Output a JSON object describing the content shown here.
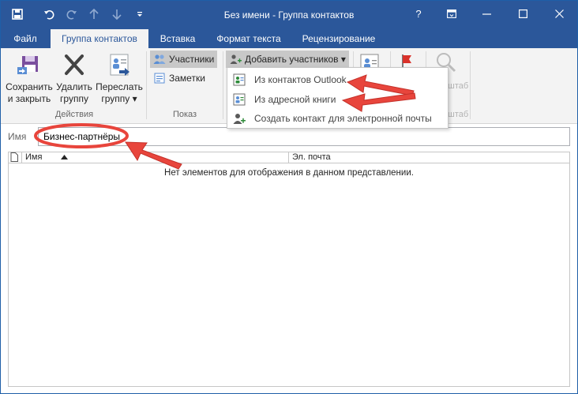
{
  "window": {
    "title": "Без имени - Группа контактов",
    "controls": {
      "help": "?",
      "ribbon_options": "ribbon-display-options-icon",
      "minimize": "minimize-icon",
      "maximize": "maximize-icon",
      "close": "close-icon"
    }
  },
  "quick_access": [
    "save-icon",
    "undo-icon",
    "redo-icon",
    "up-icon",
    "down-icon",
    "customize-icon"
  ],
  "tabs": [
    "Файл",
    "Группа контактов",
    "Вставка",
    "Формат текста",
    "Рецензирование"
  ],
  "active_tab": 1,
  "ribbon": {
    "actions": {
      "label": "Действия",
      "save_close": [
        "Сохранить",
        "и закрыть"
      ],
      "delete_group": [
        "Удалить",
        "группу"
      ],
      "forward_group": [
        "Переслать",
        "группу ▾"
      ]
    },
    "show": {
      "label": "Показ",
      "members": "Участники",
      "notes": "Заметки"
    },
    "add_members": "Добавить участников ▾",
    "ghost_labels": {
      "scale_top": "штаб",
      "scale_bottom": "штаб"
    }
  },
  "dropdown": {
    "items": [
      {
        "label": "Из контактов Outlook"
      },
      {
        "label": "Из адресной книги"
      },
      {
        "label": "Создать контакт для электронной почты"
      }
    ]
  },
  "name_field": {
    "label": "Имя",
    "value": "Бизнес-партнёры"
  },
  "list": {
    "columns": [
      "Имя",
      "Эл. почта"
    ],
    "empty_message": "Нет элементов для отображения в данном представлении."
  },
  "colors": {
    "title_bar": "#2b579a",
    "ribbon_bg": "#f3f3f3",
    "annotation": "#e8453c"
  }
}
